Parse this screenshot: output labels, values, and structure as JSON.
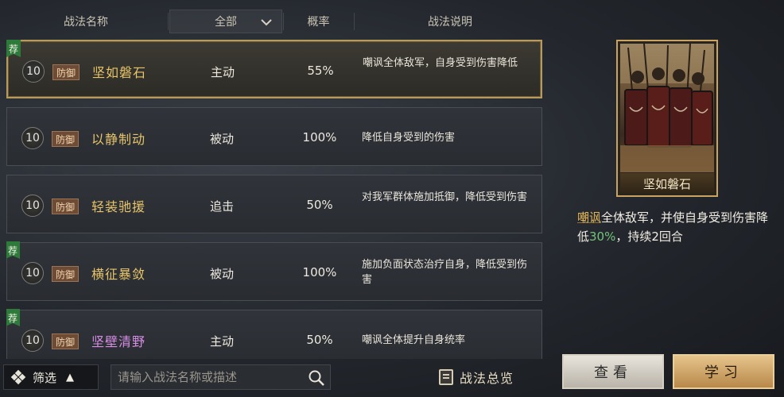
{
  "header": {
    "name_col": "战法名称",
    "filter_value": "全部",
    "rate_col": "概率",
    "desc_col": "战法说明"
  },
  "tactics": [
    {
      "recommended": true,
      "rec_label": "荐",
      "level": "10",
      "category": "防御",
      "name": "坚如磐石",
      "name_color": "#e7c46a",
      "type": "主动",
      "rate": "55%",
      "desc": "嘲讽全体敌军，自身受到伤害降低",
      "selected": true
    },
    {
      "recommended": false,
      "rec_label": "",
      "level": "10",
      "category": "防御",
      "name": "以静制动",
      "name_color": "#e7c46a",
      "type": "被动",
      "rate": "100%",
      "desc": "降低自身受到的伤害",
      "selected": false
    },
    {
      "recommended": false,
      "rec_label": "",
      "level": "10",
      "category": "防御",
      "name": "轻装驰援",
      "name_color": "#e7c46a",
      "type": "追击",
      "rate": "50%",
      "desc": "对我军群体施加抵御，降低受到伤害",
      "selected": false
    },
    {
      "recommended": true,
      "rec_label": "荐",
      "level": "10",
      "category": "防御",
      "name": "横征暴敛",
      "name_color": "#e7c46a",
      "type": "被动",
      "rate": "100%",
      "desc": "施加负面状态治疗自身，降低受到伤害",
      "selected": false
    },
    {
      "recommended": true,
      "rec_label": "荐",
      "level": "10",
      "category": "防御",
      "name": "坚壁清野",
      "name_color": "#d88ce6",
      "type": "主动",
      "rate": "50%",
      "desc": "嘲讽全体提升自身统率",
      "selected": false
    }
  ],
  "bottom": {
    "filter_label": "筛选",
    "filter_arrow": "▲",
    "search_placeholder": "请输入战法名称或描述",
    "overview_label": "战法总览"
  },
  "detail": {
    "card_title": "坚如磐石",
    "desc_keyword": "嘲讽",
    "desc_part1": "全体敌军，并使自身受到伤害降低",
    "desc_value": "30%",
    "desc_part2": "，持续2回合"
  },
  "buttons": {
    "view": "查看",
    "learn": "学习"
  },
  "icons": {
    "filter_chevron": "chevron-down-icon",
    "search": "search-icon",
    "filter": "diamond-grid-icon",
    "overview": "book-icon"
  }
}
